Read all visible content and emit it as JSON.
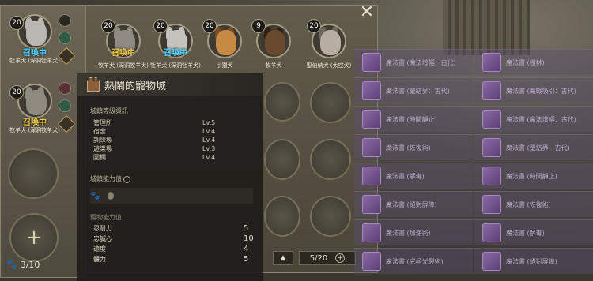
{
  "window": {
    "close_label": "✕"
  },
  "left_slots": [
    {
      "level": "20",
      "status": "召喚中",
      "status_style": "blue",
      "name": "牡羊犬 (深洞牡羊犬)",
      "color": "#b9b7b2"
    },
    {
      "level": "20",
      "status": "召喚中",
      "status_style": "gold",
      "name": "牧羊犬 (深洞牧羊犬)",
      "color": "#8f8a7f"
    }
  ],
  "pet_row": [
    {
      "level": "20",
      "status": "召喚中",
      "status_style": "gold",
      "name": "牧羊犬 (深洞牧羊犬)",
      "color": "#8e8a82"
    },
    {
      "level": "20",
      "status": "召喚中",
      "status_style": "blue",
      "name": "牡羊犬 (深洞牡羊犬)",
      "color": "#c4c2bc"
    },
    {
      "level": "20",
      "status": "",
      "status_style": "",
      "name": "小獵犬",
      "color": "#c78a45"
    },
    {
      "level": "9",
      "status": "",
      "status_style": "",
      "name": "牧羊犬",
      "color": "#6a4a2c"
    },
    {
      "level": "20",
      "status": "",
      "status_style": "",
      "name": "聖伯納犬 (太空犬)",
      "color": "#b7ada0"
    }
  ],
  "pet_count": {
    "icon": "paw-icon",
    "value": "3/10"
  },
  "pagination": {
    "current": "5/20"
  },
  "popup": {
    "title": "熱鬧的寵物城",
    "facility_section": "城鎮等級資訊",
    "facilities": [
      {
        "name": "管理所",
        "level": "Lv.5"
      },
      {
        "name": "宿舍",
        "level": "Lv.4"
      },
      {
        "name": "訓練場",
        "level": "Lv.4"
      },
      {
        "name": "遊樂場",
        "level": "Lv.3"
      },
      {
        "name": "圍欄",
        "level": "Lv.4"
      }
    ],
    "power_section": "城鎮能力值",
    "attr_section": "寵物能力值",
    "attributes": [
      {
        "name": "忍耐力",
        "value": "5"
      },
      {
        "name": "忠誠心",
        "value": "10"
      },
      {
        "name": "速度",
        "value": "4"
      },
      {
        "name": "體力",
        "value": "5"
      }
    ]
  },
  "books": [
    "魔法書 (魔法增幅：古代)",
    "魔法書 (樹林)",
    "魔法書 (聖結界：古代)",
    "魔法書 (魔戰吸引：古代)",
    "魔法書 (時間靜止)",
    "魔法書 (魔法增幅：古代)",
    "魔法書 (恢復術)",
    "魔法書 (聖結界：古代)",
    "魔法書 (解毒)",
    "魔法書 (時間靜止)",
    "魔法書 (絕對屏障)",
    "魔法書 (恢復術)",
    "魔法書 (加速術)",
    "魔法書 (解毒)",
    "魔法書 (究極光裂術)",
    "魔法書 (絕對屏障)"
  ]
}
